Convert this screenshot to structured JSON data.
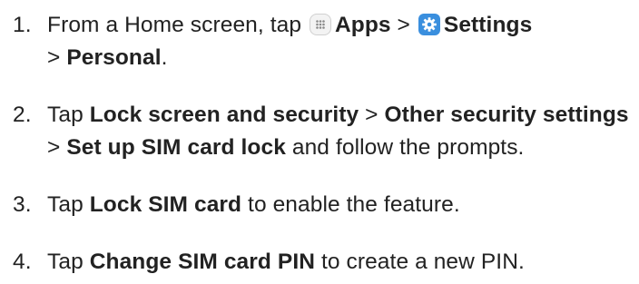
{
  "steps": [
    {
      "number": "1.",
      "t1": "From a Home screen, tap ",
      "apps_label": "Apps",
      "sep1": " > ",
      "settings_label": "Settings",
      "sep2": " > ",
      "personal_label": "Personal",
      "end": ".",
      "icons": [
        "apps-icon",
        "settings-icon"
      ]
    },
    {
      "number": "2.",
      "t1": "Tap ",
      "b1": "Lock screen and security",
      "sep1": " > ",
      "b2": "Other security settings",
      "sep2": " > ",
      "b3": "Set up SIM card lock",
      "t2": " and follow the prompts."
    },
    {
      "number": "3.",
      "t1": "Tap ",
      "b1": "Lock SIM card",
      "t2": " to enable the feature."
    },
    {
      "number": "4.",
      "t1": "Tap ",
      "b1": "Change SIM card PIN",
      "t2": " to create a new PIN."
    }
  ]
}
